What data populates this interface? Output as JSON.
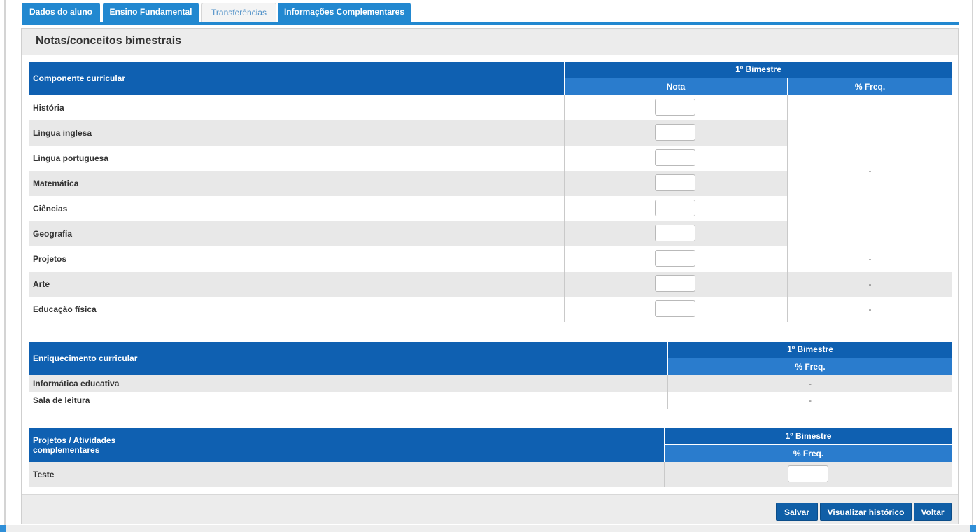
{
  "tabs": [
    {
      "label": "Dados do aluno",
      "active": true
    },
    {
      "label": "Ensino Fundamental",
      "active": true
    },
    {
      "label": "Transferências",
      "active": false
    },
    {
      "label": "Informações Complementares",
      "active": true
    }
  ],
  "panel": {
    "title": "Notas/conceitos bimestrais"
  },
  "table_curricular": {
    "header_component": "Componente curricular",
    "header_period": "1º Bimestre",
    "header_grade": "Nota",
    "header_freq": "% Freq.",
    "rows": [
      {
        "label": "História"
      },
      {
        "label": "Língua inglesa"
      },
      {
        "label": "Língua portuguesa"
      },
      {
        "label": "Matemática"
      },
      {
        "label": "Ciências"
      },
      {
        "label": "Geografia"
      },
      {
        "label": "Projetos"
      },
      {
        "label": "Arte"
      },
      {
        "label": "Educação física"
      }
    ],
    "freq_merged_value": "-",
    "freq_values": [
      "-",
      "-",
      "-"
    ]
  },
  "table_enrichment": {
    "header_component": "Enriquecimento curricular",
    "header_period": "1º Bimestre",
    "header_freq": "% Freq.",
    "rows": [
      {
        "label": "Informática educativa",
        "freq": "-"
      },
      {
        "label": "Sala de leitura",
        "freq": "-"
      }
    ]
  },
  "table_projects": {
    "header_component": "Projetos / Atividades complementares",
    "header_period": "1º Bimestre",
    "header_freq": "% Freq.",
    "rows": [
      {
        "label": "Teste"
      }
    ]
  },
  "footer": {
    "save_label": "Salvar",
    "history_label": "Visualizar histórico",
    "back_label": "Voltar"
  },
  "colors": {
    "tab_active": "#2288d0",
    "header_dark": "#0f60b1",
    "header_light": "#2a7ccd",
    "button": "#105fa7"
  }
}
